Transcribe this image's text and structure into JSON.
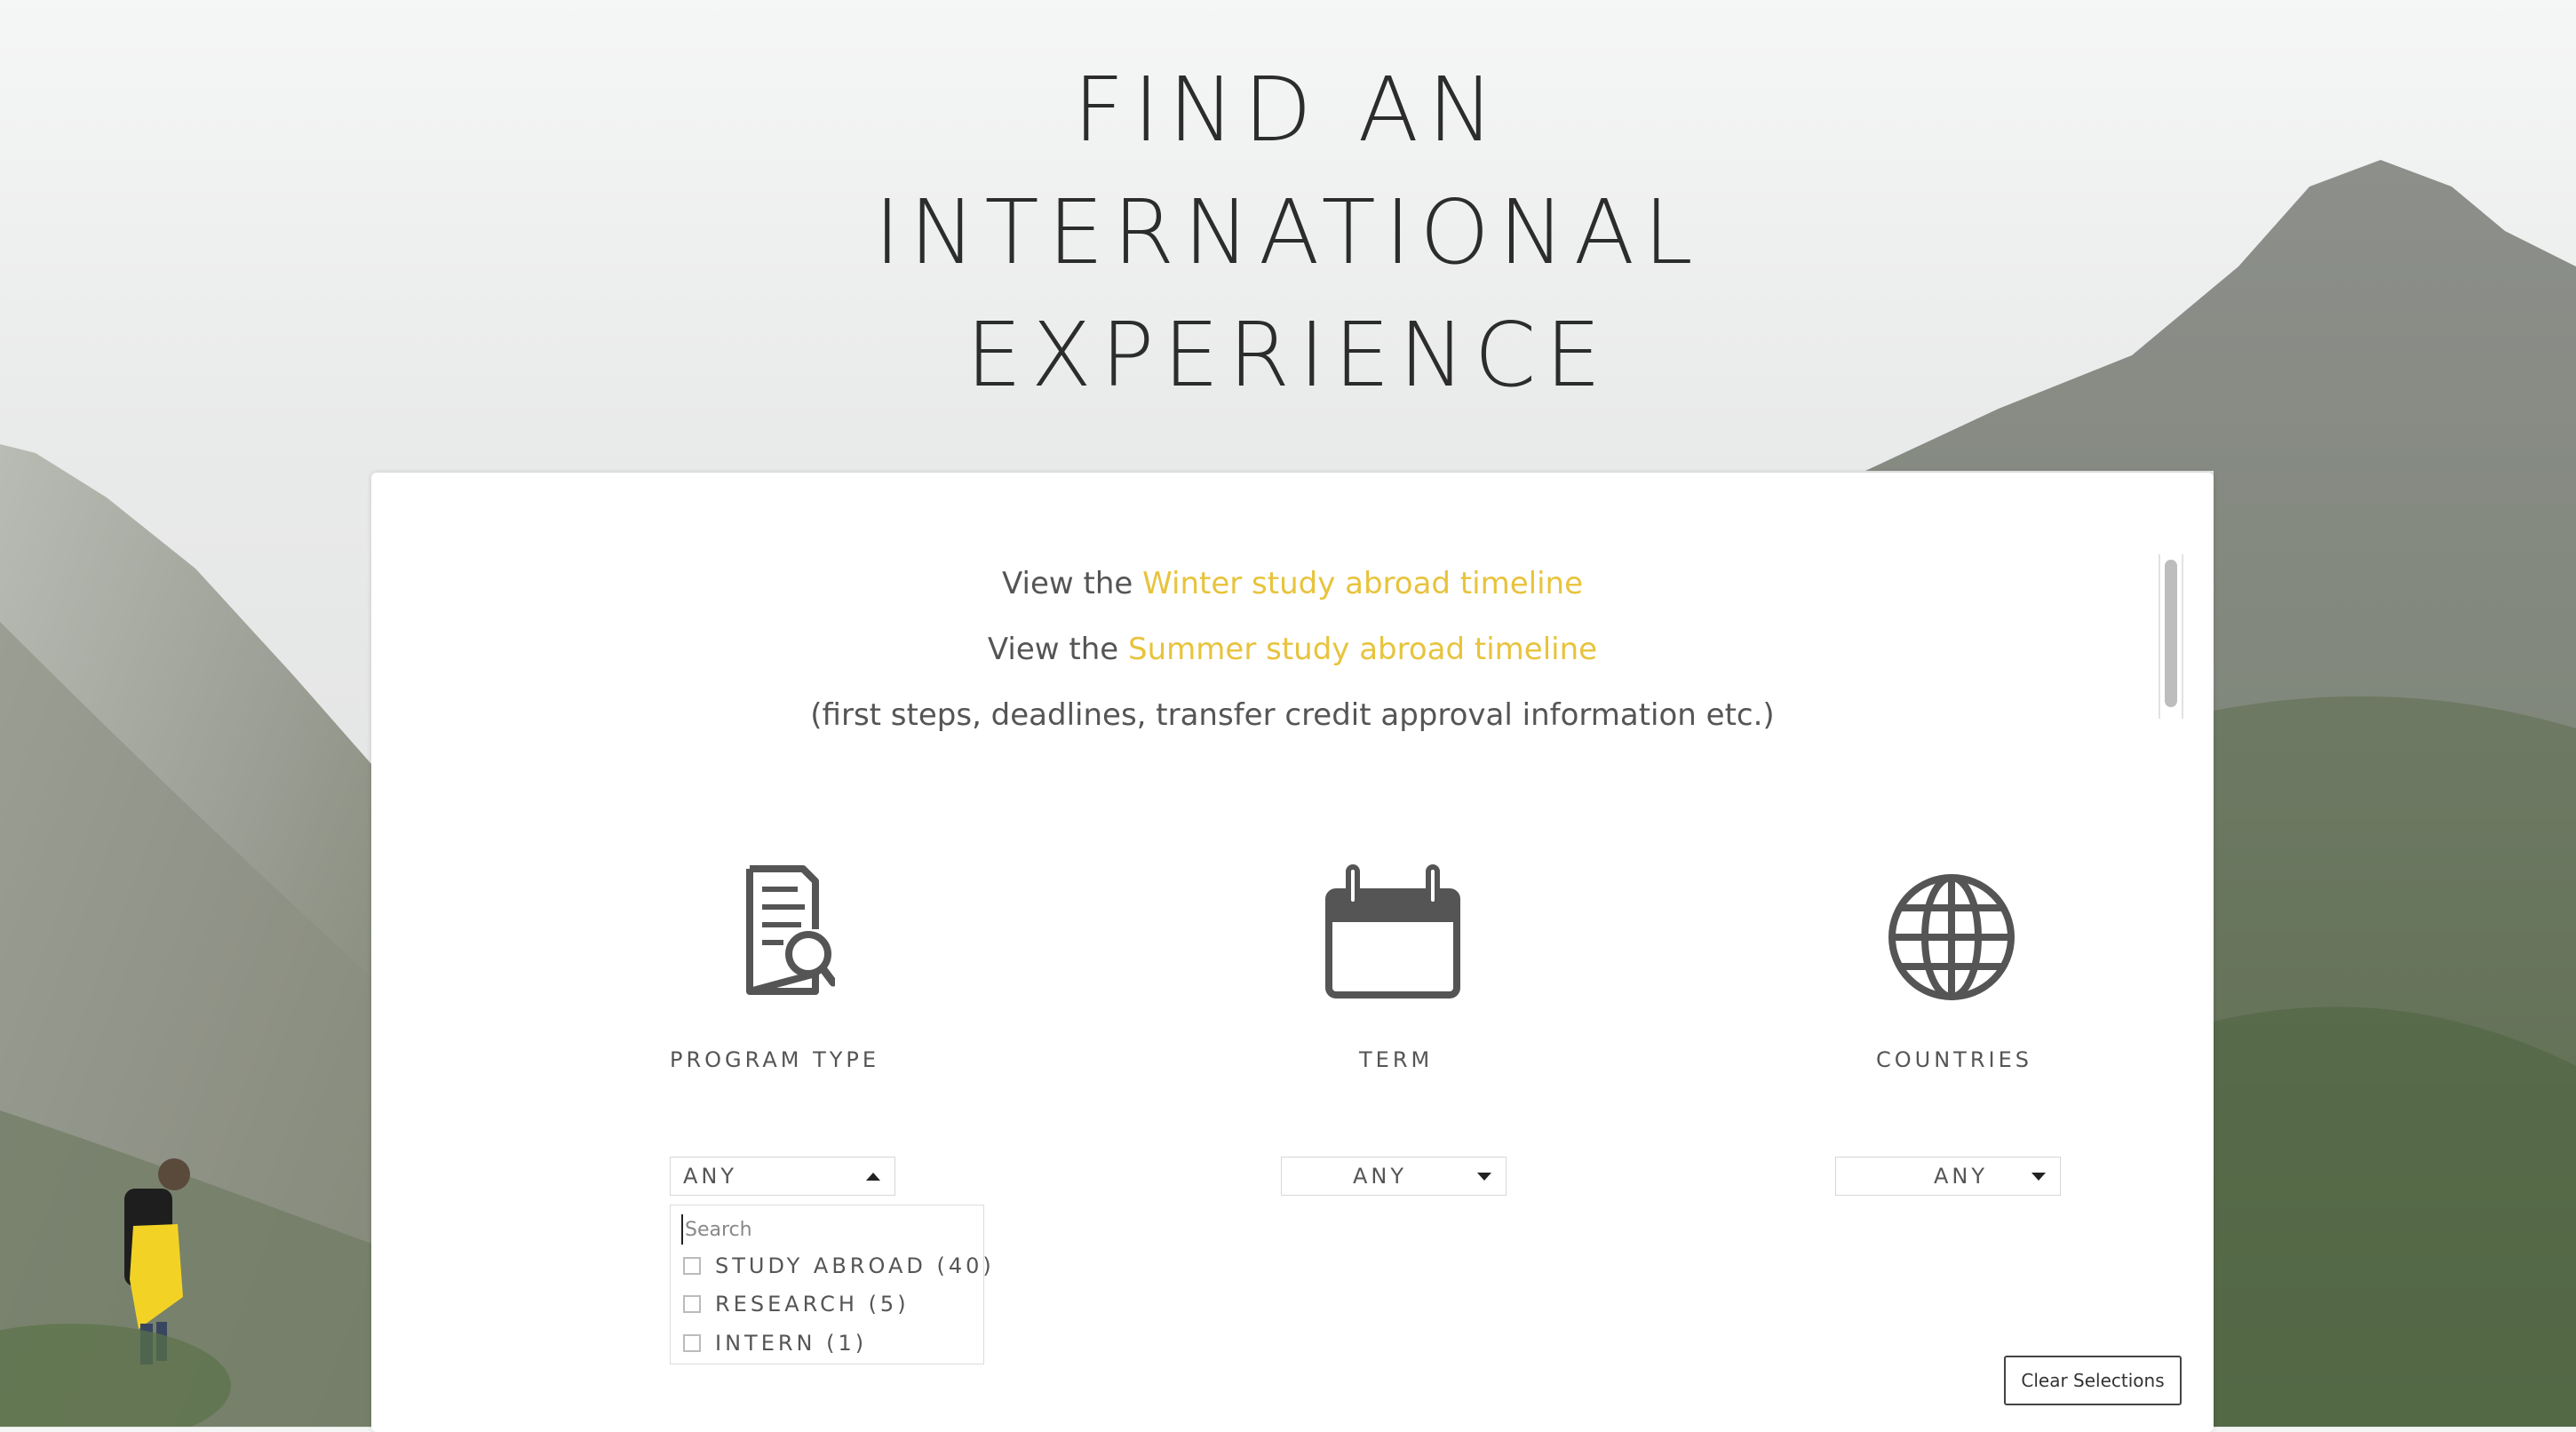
{
  "hero": {
    "title_line1": "FIND AN",
    "title_line2": "INTERNATIONAL",
    "title_line3": "EXPERIENCE"
  },
  "timeline": {
    "line1_prefix": "View the ",
    "line1_link": "Winter study abroad timeline",
    "line2_prefix": "View the ",
    "line2_link": "Summer study abroad timeline",
    "line3": "(first steps, deadlines, transfer credit approval information etc.)"
  },
  "filters": {
    "program_type": {
      "label": "PROGRAM TYPE",
      "icon": "document-search-icon",
      "value": "ANY",
      "expanded": true
    },
    "term": {
      "label": "TERM",
      "icon": "calendar-icon",
      "value": "ANY",
      "expanded": false
    },
    "countries": {
      "label": "COUNTRIES",
      "icon": "globe-icon",
      "value": "ANY",
      "expanded": false
    }
  },
  "dropdown": {
    "search_placeholder": "Search",
    "options": [
      {
        "label": "STUDY ABROAD (40)",
        "checked": false
      },
      {
        "label": "RESEARCH (5)",
        "checked": false
      },
      {
        "label": "INTERN (1)",
        "checked": false
      }
    ]
  },
  "clear_button": "Clear Selections",
  "colors": {
    "link": "#e8c33c",
    "text": "#555555",
    "title": "#2c2c2c",
    "icon": "#555555"
  }
}
